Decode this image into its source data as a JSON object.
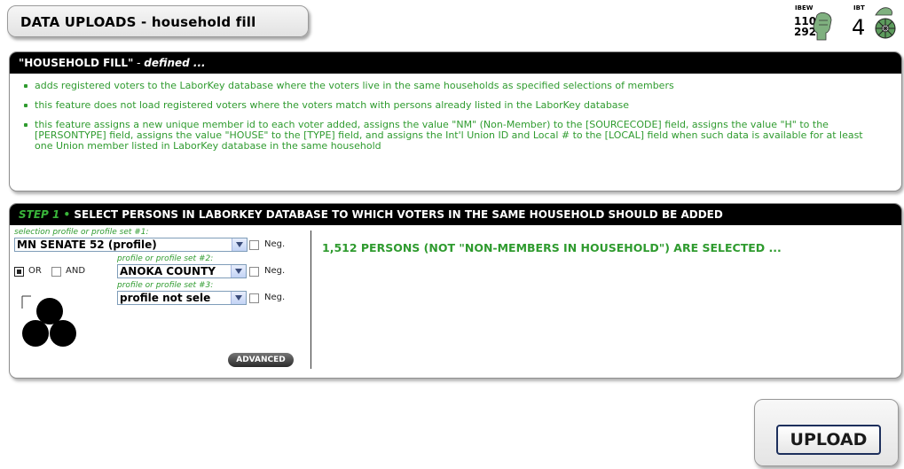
{
  "page": {
    "title": "DATA UPLOADS  -  household fill"
  },
  "logos": [
    {
      "text_top": "IBEW",
      "text_lines": [
        "110",
        "292"
      ],
      "icon": "fist-icon"
    },
    {
      "text_top": "IBT",
      "number": "4",
      "icon": "wheel-horse-icon"
    }
  ],
  "definition": {
    "header_main": "\"HOUSEHOLD FILL\"",
    "header_sep": " - ",
    "header_em": "defined ...",
    "bullets": [
      "adds registered voters to the LaborKey database where the voters live in the same households as specified selections of members",
      "this feature does not load registered voters where the voters match with persons already listed in the LaborKey database",
      "this feature assigns a new unique member id to each voter added, assigns the value \"NM\" (Non-Member) to the [SOURCECODE] field, assigns the value \"H\" to the [PERSONTYPE] field, assigns the value \"HOUSE\" to the [TYPE] field, and assigns the Int'l Union ID and Local # to the [LOCAL] field when such data is available for at least one Union member listed in LaborKey database in the same household"
    ]
  },
  "step1": {
    "step_label": "STEP 1",
    "bullet": "•",
    "title": "SELECT PERSONS IN LABORKEY DATABASE TO WHICH VOTERS IN THE SAME HOUSEHOLD SHOULD BE ADDED",
    "profile1": {
      "caption": "selection profile or profile set #1:",
      "value": "MN SENATE 52 (profile)",
      "neg_label": "Neg."
    },
    "profile2": {
      "caption": "profile or profile set #2:",
      "value": "ANOKA COUNTY",
      "neg_label": "Neg."
    },
    "profile3": {
      "caption": "profile or profile set #3:",
      "value": "profile not sele",
      "neg_label": "Neg."
    },
    "or_label": "OR",
    "and_label": "AND",
    "or_checked": true,
    "and_checked": false,
    "advanced_label": "ADVANCED",
    "selected_message": "1,512 PERSONS (NOT \"NON-MEMBERS IN HOUSEHOLD\") ARE SELECTED ..."
  },
  "upload": {
    "label": "UPLOAD"
  },
  "colors": {
    "green": "#2f9b2f",
    "header_bg": "#000000",
    "step_green": "#39b53a"
  }
}
